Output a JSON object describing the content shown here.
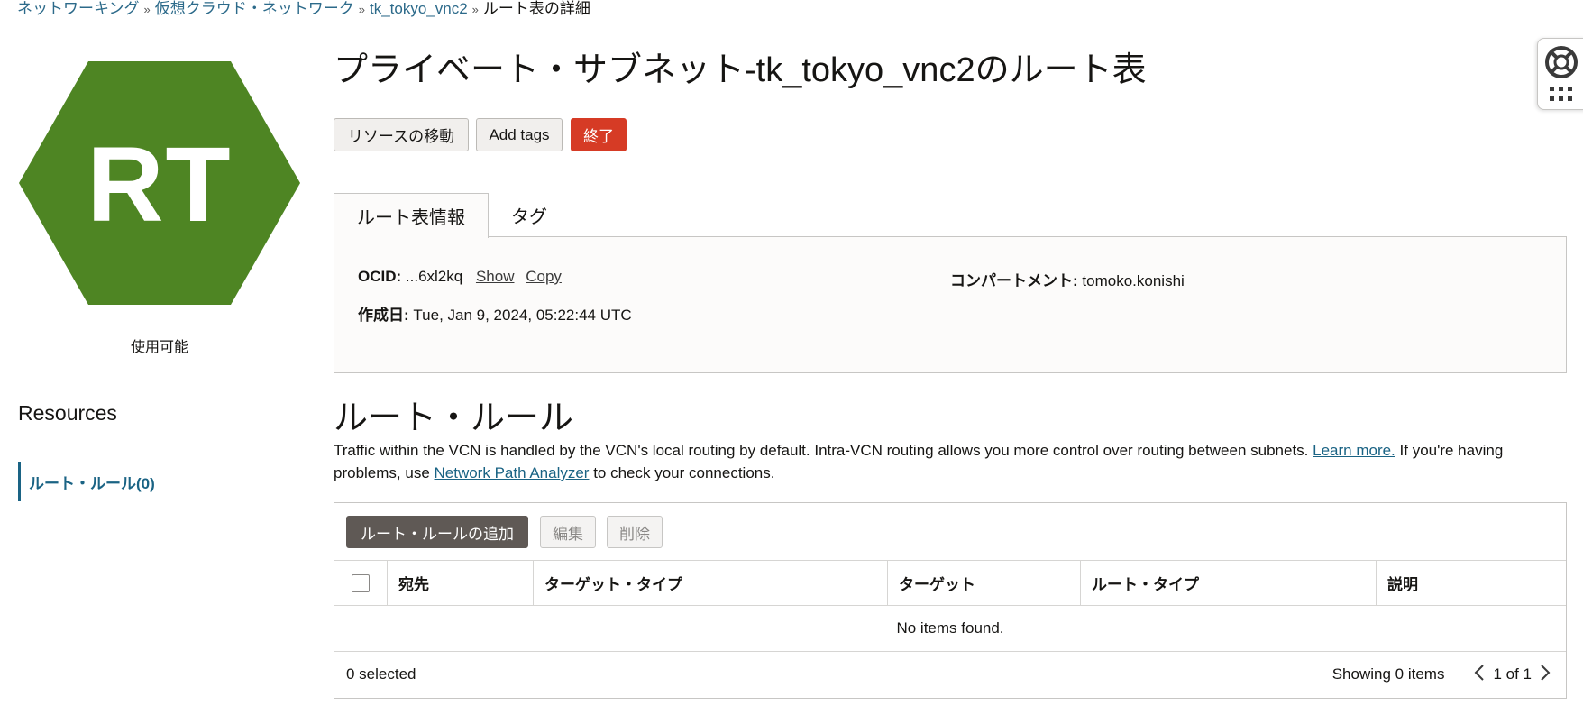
{
  "breadcrumb": {
    "items": [
      "ネットワーキング",
      "仮想クラウド・ネットワーク",
      "tk_tokyo_vnc2"
    ],
    "current": "ルート表の詳細",
    "separator": "»"
  },
  "resource_icon": {
    "initials": "RT",
    "color": "#4e8523",
    "status": "使用可能"
  },
  "resources": {
    "title": "Resources",
    "items": [
      {
        "label": "ルート・ルール(0)",
        "active": true
      }
    ]
  },
  "page": {
    "title": "プライベート・サブネット-tk_tokyo_vnc2のルート表"
  },
  "actions": {
    "move": "リソースの移動",
    "add_tags": "Add tags",
    "terminate": "終了"
  },
  "tabs": [
    {
      "label": "ルート表情報",
      "active": true
    },
    {
      "label": "タグ",
      "active": false
    }
  ],
  "info": {
    "ocid_label": "OCID:",
    "ocid_value": "...6xl2kq",
    "show": "Show",
    "copy": "Copy",
    "created_label": "作成日:",
    "created_value": "Tue, Jan 9, 2024, 05:22:44 UTC",
    "compartment_label": "コンパートメント:",
    "compartment_value": "tomoko.konishi"
  },
  "route_rules": {
    "title": "ルート・ルール",
    "desc_1": "Traffic within the VCN is handled by the VCN's local routing by default. Intra-VCN routing allows you more control over routing between subnets. ",
    "learn_more": "Learn more.",
    "desc_2": " If you're having problems, use ",
    "analyzer_link": "Network Path Analyzer",
    "desc_3": " to check your connections.",
    "toolbar": {
      "add": "ルート・ルールの追加",
      "edit": "編集",
      "delete": "削除"
    },
    "columns": [
      "宛先",
      "ターゲット・タイプ",
      "ターゲット",
      "ルート・タイプ",
      "説明"
    ],
    "empty": "No items found.",
    "selected": "0 selected",
    "showing": "Showing 0 items",
    "page_info": "1 of 1"
  },
  "colors": {
    "accent": "#1a6384",
    "danger": "#d63b25",
    "primary_dark": "#5f5955"
  }
}
